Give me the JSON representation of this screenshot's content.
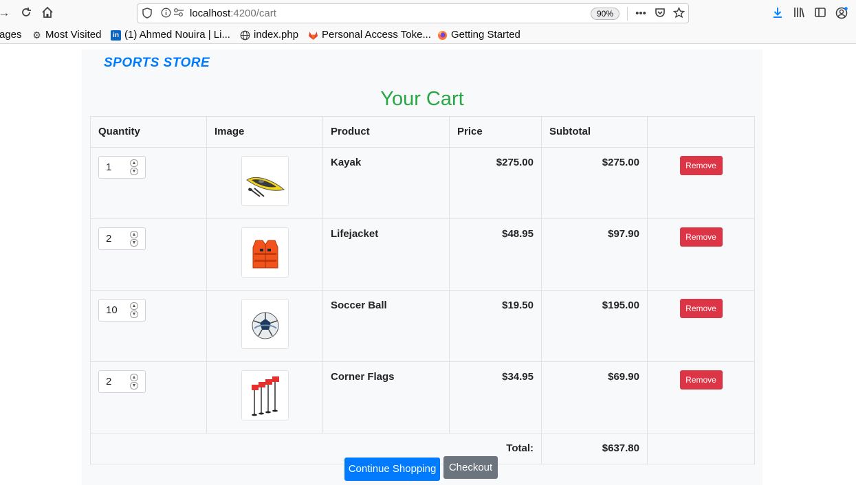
{
  "browser": {
    "url_host": "localhost",
    "url_path": ":4200/cart",
    "zoom": "90%"
  },
  "bookmarks": [
    {
      "label": "ages",
      "icon": "folder-icon"
    },
    {
      "label": "Most Visited",
      "icon": "gear-icon"
    },
    {
      "label": "(1) Ahmed Nouira | Li...",
      "icon": "linkedin-icon"
    },
    {
      "label": "index.php",
      "icon": "globe-icon"
    },
    {
      "label": "Personal Access Toke...",
      "icon": "gitlab-icon"
    },
    {
      "label": "Getting Started",
      "icon": "firefox-icon"
    }
  ],
  "store": {
    "brand": "SPORTS STORE",
    "title": "Your Cart"
  },
  "table": {
    "headers": {
      "quantity": "Quantity",
      "image": "Image",
      "product": "Product",
      "price": "Price",
      "subtotal": "Subtotal"
    },
    "rows": [
      {
        "quantity": "1",
        "product": "Kayak",
        "price": "$275.00",
        "subtotal": "$275.00",
        "remove": "Remove",
        "image": "kayak-image"
      },
      {
        "quantity": "2",
        "product": "Lifejacket",
        "price": "$48.95",
        "subtotal": "$97.90",
        "remove": "Remove",
        "image": "lifejacket-image"
      },
      {
        "quantity": "10",
        "product": "Soccer Ball",
        "price": "$19.50",
        "subtotal": "$195.00",
        "remove": "Remove",
        "image": "soccer-ball-image"
      },
      {
        "quantity": "2",
        "product": "Corner Flags",
        "price": "$34.95",
        "subtotal": "$69.90",
        "remove": "Remove",
        "image": "corner-flags-image"
      }
    ],
    "total_label": "Total:",
    "total_value": "$637.80"
  },
  "actions": {
    "continue": "Continue Shopping",
    "checkout": "Checkout"
  },
  "colors": {
    "brand": "#007bff",
    "title": "#28a745",
    "remove": "#dc3545",
    "checkout": "#6c757d"
  }
}
